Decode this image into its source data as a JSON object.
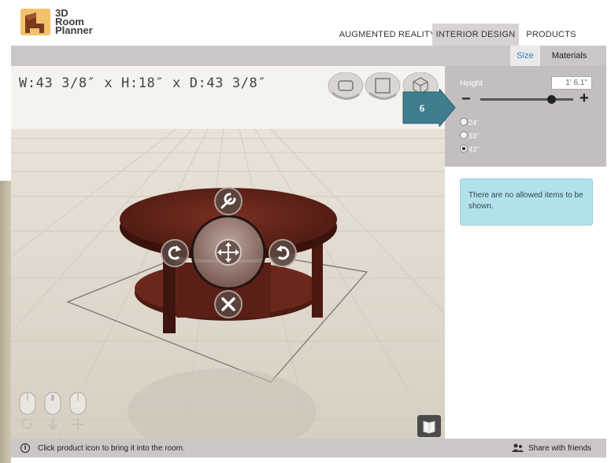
{
  "app": {
    "logo_lines": [
      "3D",
      "Room",
      "Planner"
    ]
  },
  "nav": {
    "tabs": [
      {
        "label": "AUGMENTED REALITY",
        "active": false
      },
      {
        "label": "INTERIOR DESIGN",
        "active": true
      },
      {
        "label": "PRODUCTS",
        "active": false
      }
    ]
  },
  "subnav": {
    "size_label": "Size",
    "materials_label": "Materials"
  },
  "viewer": {
    "dimensions_text": "W:43 3/8″ x H:18″ x D:43 3/8″",
    "view_buttons": [
      "perspective-view-icon",
      "top-view-icon",
      "3d-box-view-icon"
    ],
    "object_controls": [
      "wrench-icon",
      "rotate-clockwise-icon",
      "move-icon",
      "rotate-counterclockwise-icon",
      "delete-icon"
    ],
    "nav_controls": [
      "mouse-left-icon",
      "mouse-middle-icon",
      "mouse-right-icon",
      "rotate-icon",
      "down-arrow-icon",
      "pan-icon"
    ],
    "catalog_icon": "catalog-book-icon"
  },
  "size_panel": {
    "height_label": "Height",
    "height_value": "1' 6.1\"",
    "slider_level": 0.77,
    "callout_number": "6",
    "options": [
      {
        "label": "24\"",
        "selected": false
      },
      {
        "label": "33\"",
        "selected": false
      },
      {
        "label": "43\"",
        "selected": true
      }
    ]
  },
  "notice": {
    "text": "There are no allowed items to be shown."
  },
  "statusbar": {
    "hint": "Click product icon to bring it into the room.",
    "share_label": "Share with friends"
  },
  "colors": {
    "active_tab": "#d7d3d4",
    "size_link": "#2b7fc2",
    "callout": "#3f7d8f",
    "notice_bg": "#b1e2ec",
    "wood": "#5a1f17"
  }
}
